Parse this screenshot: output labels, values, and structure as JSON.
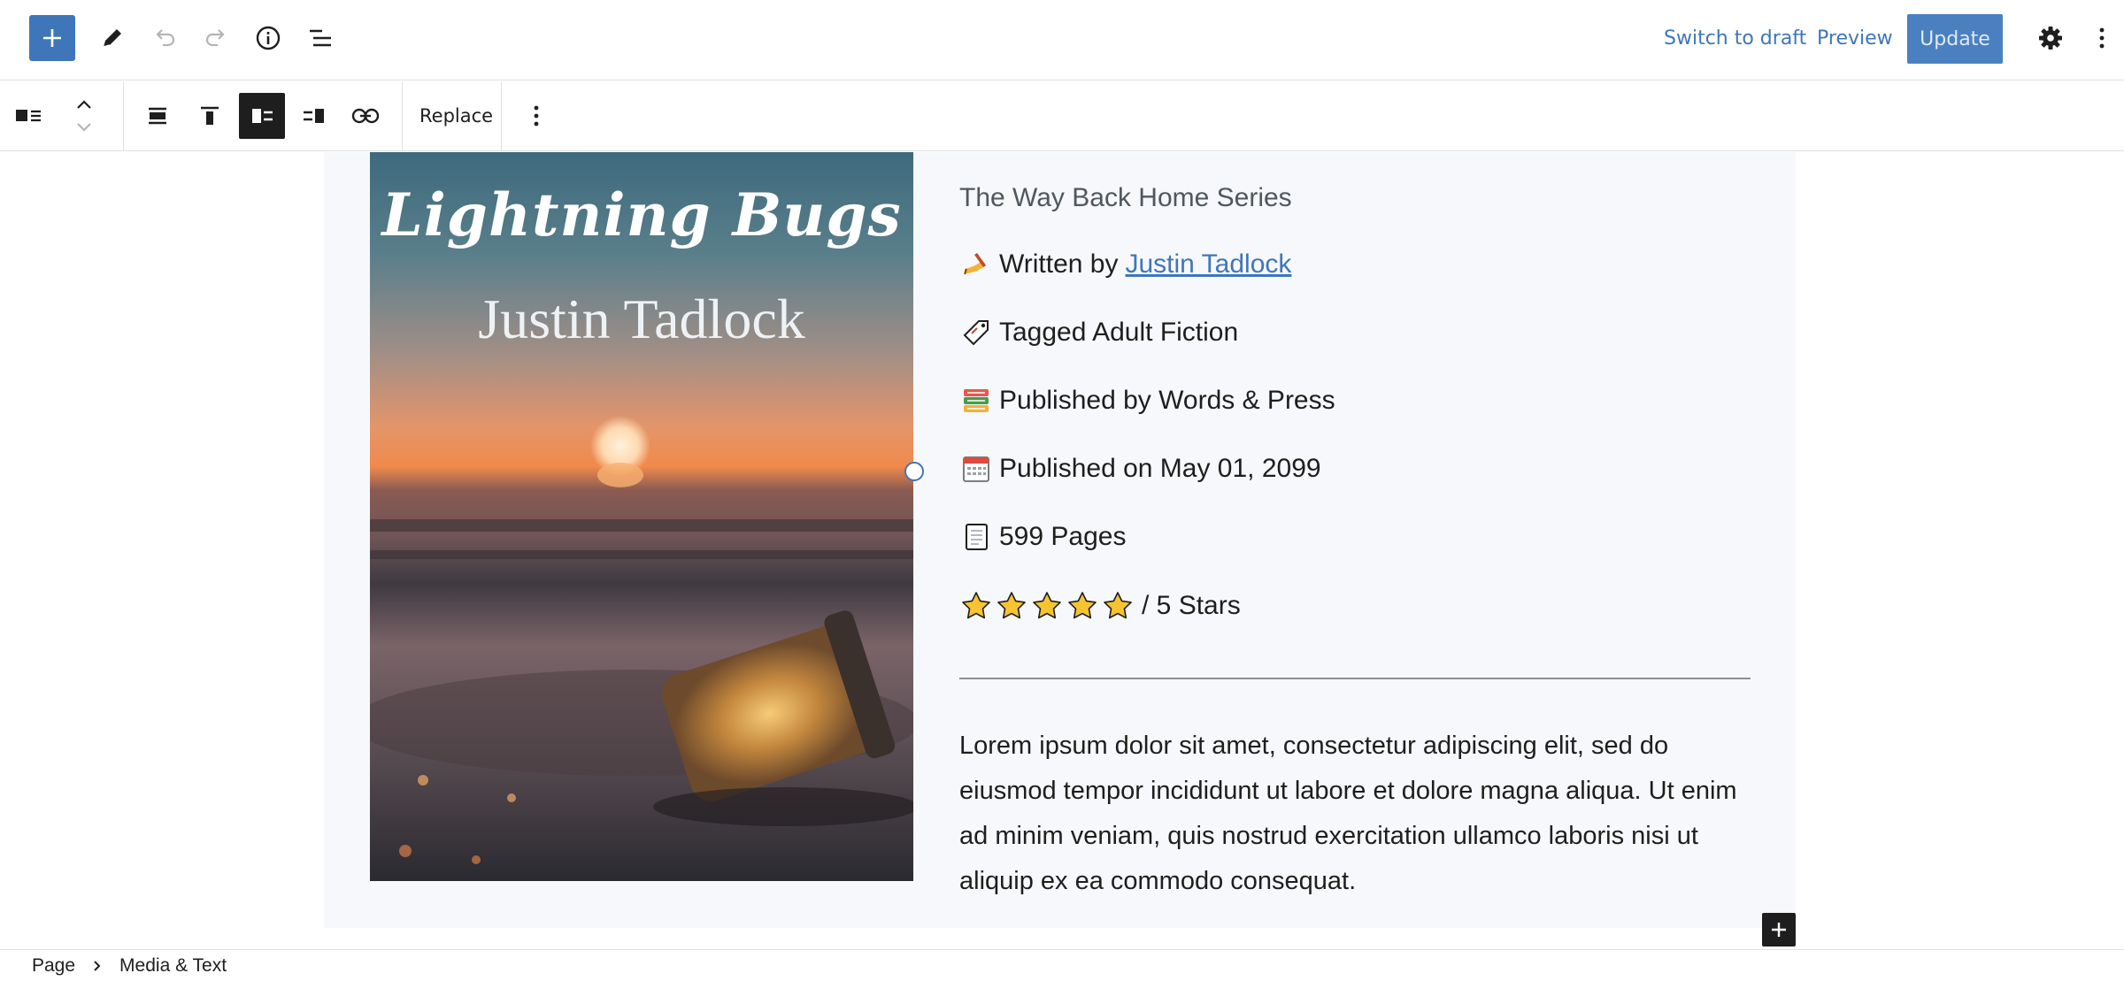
{
  "header": {
    "switch_to_draft": "Switch to draft",
    "preview": "Preview",
    "update": "Update",
    "accent_color": "#3f76b9"
  },
  "block_toolbar": {
    "replace_label": "Replace"
  },
  "book": {
    "cover_title": "Lightning Bugs",
    "cover_author": "Justin Tadlock",
    "series": "The Way Back Home Series",
    "written_by_label": "Written by",
    "author_link": "Justin Tadlock",
    "tagged": "Tagged Adult Fiction",
    "publisher": "Published by Words & Press",
    "published_on": "Published on May 01, 2099",
    "pages": "599 Pages",
    "rating": {
      "value": 5,
      "max": 5,
      "label": "/ 5 Stars"
    },
    "description": "Lorem ipsum dolor sit amet, consectetur adipiscing elit, sed do eiusmod tempor incididunt ut labore et dolore magna aliqua. Ut enim ad minim veniam, quis nostrud exercitation ullamco laboris nisi ut aliquip ex ea commodo consequat."
  },
  "breadcrumb": {
    "items": [
      "Page",
      "Media & Text"
    ]
  },
  "icons": {
    "written": "writing-hand-icon",
    "tagged": "label-tag-icon",
    "publisher": "books-icon",
    "published_on": "calendar-icon",
    "pages": "page-icon",
    "star": "star-icon"
  }
}
